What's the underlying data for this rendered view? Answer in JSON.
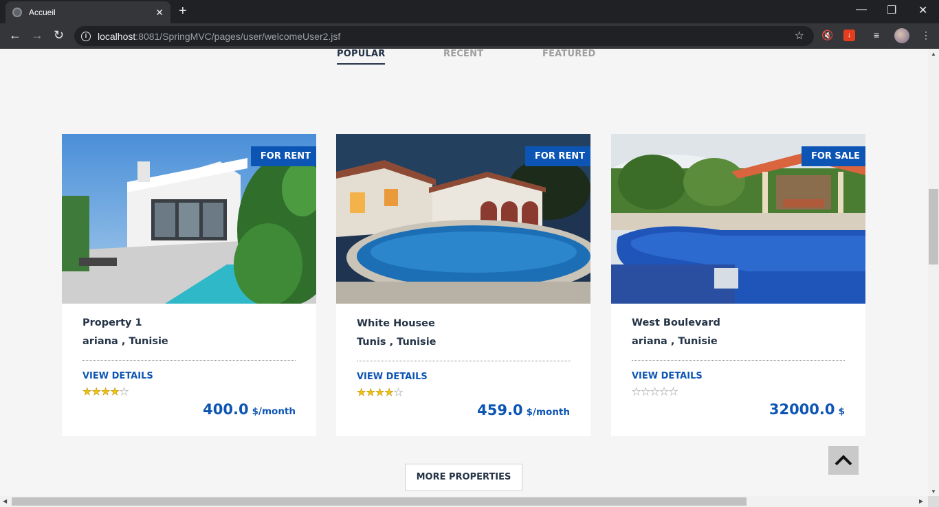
{
  "browser": {
    "tab_title": "Accueil",
    "url_host": "localhost",
    "url_rest": ":8081/SpringMVC/pages/user/welcomeUser2.jsf"
  },
  "tabs": [
    {
      "label": "POPULAR"
    },
    {
      "label": "RECENT"
    },
    {
      "label": "FEATURED"
    }
  ],
  "cards": [
    {
      "badge": "FOR RENT",
      "title": "Property 1",
      "location": "ariana , Tunisie",
      "details": "VIEW DETAILS",
      "rating": 4,
      "price": "400.0",
      "unit": "$/month"
    },
    {
      "badge": "FOR RENT",
      "title": "White Housee",
      "location": "Tunis , Tunisie",
      "details": "VIEW DETAILS",
      "rating": 4,
      "price": "459.0",
      "unit": "$/month"
    },
    {
      "badge": "FOR SALE",
      "title": "West Boulevard",
      "location": "ariana , Tunisie",
      "details": "VIEW DETAILS",
      "rating": 0,
      "price": "32000.0",
      "unit": "$"
    }
  ],
  "more_button": "MORE PROPERTIES",
  "colors": {
    "accent": "#0d55b4",
    "heading": "#243346"
  }
}
